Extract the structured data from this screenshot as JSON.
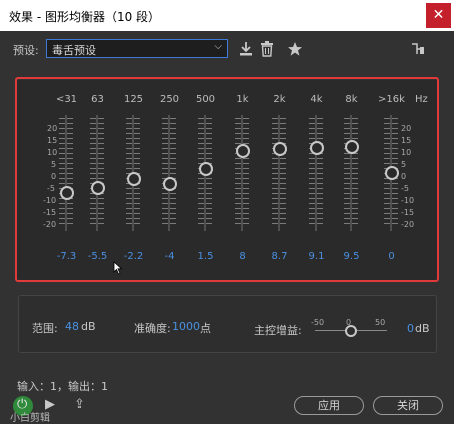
{
  "window": {
    "title": "效果 - 图形均衡器（10 段）",
    "close_glyph": "✕"
  },
  "toolbar": {
    "preset_label": "预设:",
    "preset_value": "毒舌预设",
    "caret": "⌵"
  },
  "eq": {
    "hz_unit": "Hz",
    "scale": [
      "20",
      "15",
      "10",
      "5",
      "0",
      "-5",
      "-10",
      "-15",
      "-20"
    ],
    "scale_range": [
      -20,
      20
    ],
    "bands": [
      {
        "label": "<31",
        "value": "-7.3",
        "level": -7.3
      },
      {
        "label": "63",
        "value": "-5.5",
        "level": -5.5
      },
      {
        "label": "125",
        "value": "-2.2",
        "level": -2.2
      },
      {
        "label": "250",
        "value": "-4",
        "level": -4
      },
      {
        "label": "500",
        "value": "1.5",
        "level": 1.5
      },
      {
        "label": "1k",
        "value": "8",
        "level": 8
      },
      {
        "label": "2k",
        "value": "8.7",
        "level": 8.7
      },
      {
        "label": "4k",
        "value": "9.1",
        "level": 9.1
      },
      {
        "label": "8k",
        "value": "9.5",
        "level": 9.5
      },
      {
        "label": ">16k",
        "value": "0",
        "level": 0
      }
    ]
  },
  "master": {
    "range_label": "范围:",
    "range_value": "48",
    "range_unit": "dB",
    "accuracy_label": "准确度:",
    "accuracy_value": "1000",
    "accuracy_unit": "点",
    "gain_label": "主控增益:",
    "gain_ticks": [
      "-50",
      "0",
      "50"
    ],
    "gain_value": "0",
    "gain_unit": "dB",
    "gain_level": 0
  },
  "status": {
    "io_text": "输入：1，输出：1",
    "watermark": "小白剪辑"
  },
  "buttons": {
    "apply": "应用",
    "close": "关闭",
    "play": "▶",
    "loop": "⇪",
    "power": "⏻"
  },
  "colors": {
    "accent": "#4a90e2",
    "highlight": "#e03a3a",
    "close": "#c4202c",
    "power": "#2f8a3a"
  }
}
